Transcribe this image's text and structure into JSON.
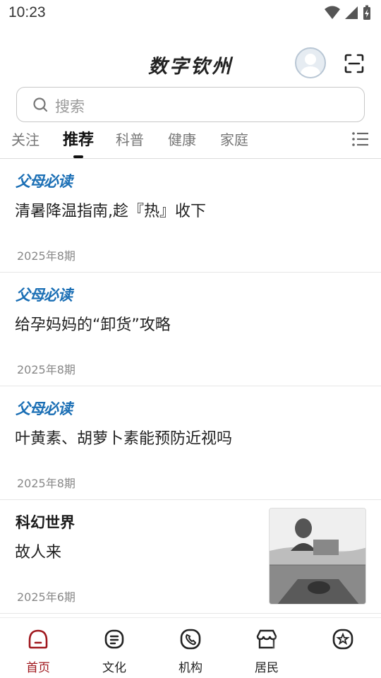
{
  "status_bar": {
    "time": "10:23"
  },
  "header": {
    "title": "数字钦州"
  },
  "search": {
    "placeholder": "搜索"
  },
  "tabs": [
    {
      "label": "关注"
    },
    {
      "label": "推荐"
    },
    {
      "label": "科普"
    },
    {
      "label": "健康"
    },
    {
      "label": "家庭"
    }
  ],
  "articles": [
    {
      "source": "父母必读",
      "title": "清暑降温指南,趁『热』收下",
      "date": "2025年8期"
    },
    {
      "source": "父母必读",
      "title": "给孕妈妈的“卸货”攻略",
      "date": "2025年8期"
    },
    {
      "source": "父母必读",
      "title": "叶黄素、胡萝卜素能预防近视吗",
      "date": "2025年8期"
    },
    {
      "source": "科幻世界",
      "title": "故人来",
      "date": "2025年6期"
    }
  ],
  "bottom_nav": [
    {
      "label": "首页",
      "icon": "home-icon"
    },
    {
      "label": "文化",
      "icon": "culture-icon"
    },
    {
      "label": "机构",
      "icon": "phone-icon"
    },
    {
      "label": "居民",
      "icon": "store-icon"
    },
    {
      "label": "",
      "icon": "star-icon"
    }
  ],
  "colors": {
    "accent": "#a0181e",
    "source_blue": "#1b6fb5"
  }
}
